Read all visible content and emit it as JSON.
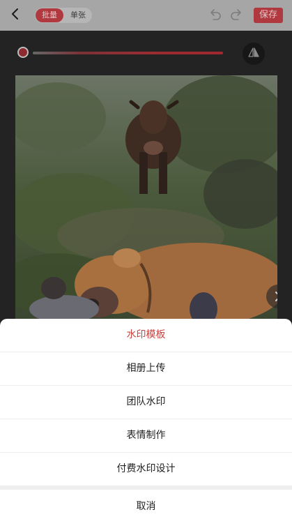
{
  "header": {
    "mode_batch": "批量",
    "mode_single": "单张",
    "save_label": "保存"
  },
  "icons": {
    "back": "chevron-left-icon",
    "undo": "undo-icon",
    "redo": "redo-icon",
    "mirror": "mirror-flip-icon",
    "next": "chevron-right-icon"
  },
  "colors": {
    "accent": "#b0393f",
    "sheet_highlight": "#c8423f"
  },
  "action_sheet": {
    "items": [
      {
        "label": "水印模板"
      },
      {
        "label": "相册上传"
      },
      {
        "label": "团队水印"
      },
      {
        "label": "表情制作"
      },
      {
        "label": "付费水印设计"
      }
    ],
    "cancel_label": "取消"
  }
}
